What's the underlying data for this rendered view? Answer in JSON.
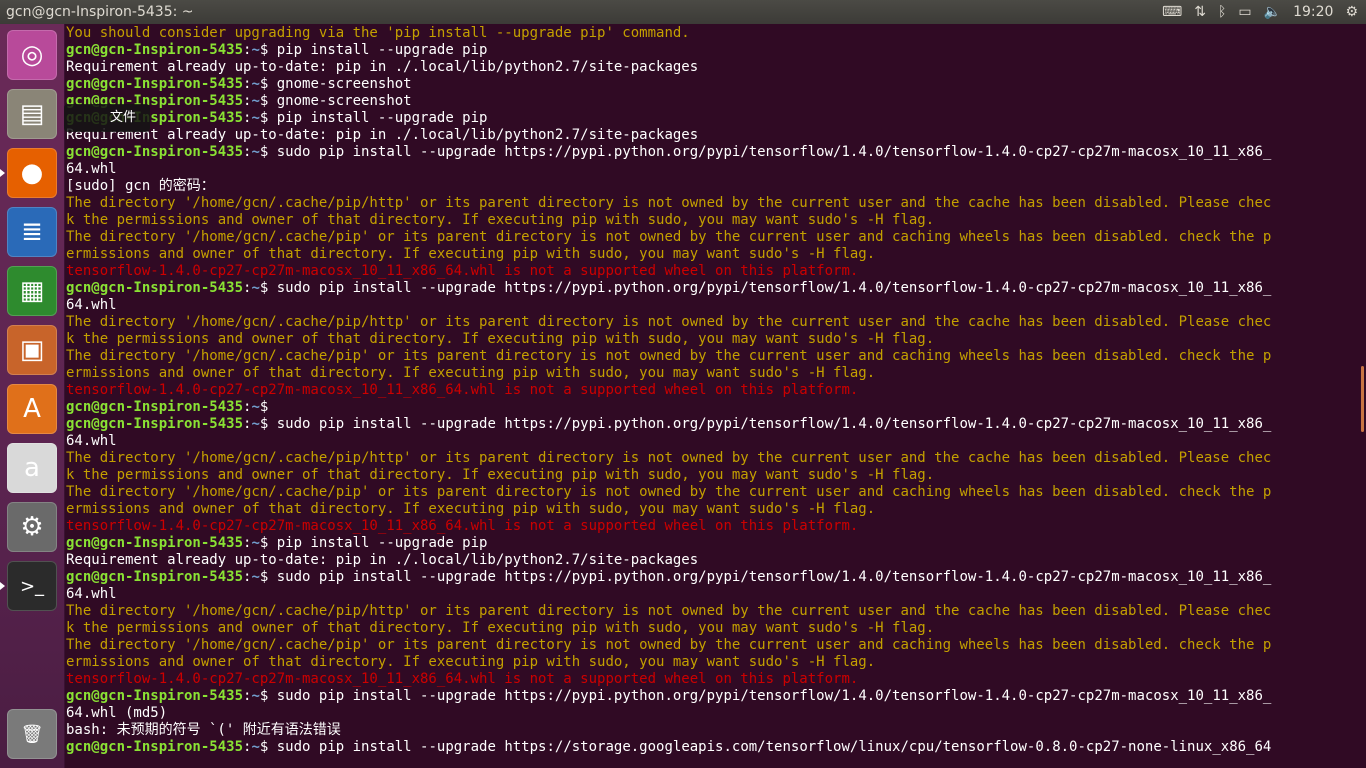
{
  "topbar": {
    "title": "gcn@gcn-Inspiron-5435: ~",
    "clock": "19:20",
    "tray_icons": [
      "keyboard-icon",
      "network-icon",
      "bluetooth-icon",
      "battery-icon",
      "volume-icon",
      "settings-icon"
    ]
  },
  "launcher": {
    "items": [
      {
        "name": "ubuntu-dash",
        "glyph": "◎",
        "color": "#b84a9a"
      },
      {
        "name": "files",
        "glyph": "▤",
        "color": "#8a8577"
      },
      {
        "name": "firefox",
        "glyph": "●",
        "color": "#e66000"
      },
      {
        "name": "writer",
        "glyph": "≣",
        "color": "#2a6ab8"
      },
      {
        "name": "calc",
        "glyph": "▦",
        "color": "#2e8b2e"
      },
      {
        "name": "impress",
        "glyph": "▣",
        "color": "#c8642a"
      },
      {
        "name": "software-center",
        "glyph": "A",
        "color": "#e0701a"
      },
      {
        "name": "amazon",
        "glyph": "a",
        "color": "#d9d9d9"
      },
      {
        "name": "system-settings",
        "glyph": "⚙",
        "color": "#6a6a6a"
      },
      {
        "name": "terminal",
        "glyph": ">_",
        "color": "#2b2b2b"
      },
      {
        "name": "trash",
        "glyph": "🗑",
        "color": "#7a7a7a"
      }
    ],
    "tooltip": "文件"
  },
  "terminal": {
    "prompt_user": "gcn@gcn-Inspiron-5435",
    "prompt_path": "~",
    "lines": [
      {
        "t": "warn",
        "text": "You should consider upgrading via the 'pip install --upgrade pip' command."
      },
      {
        "t": "prompt",
        "cmd": "pip install --upgrade pip"
      },
      {
        "t": "norm",
        "text": "Requirement already up-to-date: pip in ./.local/lib/python2.7/site-packages"
      },
      {
        "t": "prompt",
        "cmd": "gnome-screenshot"
      },
      {
        "t": "prompt",
        "cmd": "gnome-screenshot"
      },
      {
        "t": "prompt",
        "cmd": "pip install --upgrade pip"
      },
      {
        "t": "norm",
        "text": "Requirement already up-to-date: pip in ./.local/lib/python2.7/site-packages"
      },
      {
        "t": "prompt",
        "cmd": "sudo pip install --upgrade https://pypi.python.org/pypi/tensorflow/1.4.0/tensorflow-1.4.0-cp27-cp27m-macosx_10_11_x86_"
      },
      {
        "t": "norm",
        "text": "64.whl"
      },
      {
        "t": "norm",
        "text": "[sudo] gcn 的密码："
      },
      {
        "t": "warn",
        "text": "The directory '/home/gcn/.cache/pip/http' or its parent directory is not owned by the current user and the cache has been disabled. Please chec"
      },
      {
        "t": "warn",
        "text": "k the permissions and owner of that directory. If executing pip with sudo, you may want sudo's -H flag."
      },
      {
        "t": "warn",
        "text": "The directory '/home/gcn/.cache/pip' or its parent directory is not owned by the current user and caching wheels has been disabled. check the p"
      },
      {
        "t": "warn",
        "text": "ermissions and owner of that directory. If executing pip with sudo, you may want sudo's -H flag."
      },
      {
        "t": "err",
        "text": "tensorflow-1.4.0-cp27-cp27m-macosx_10_11_x86_64.whl is not a supported wheel on this platform."
      },
      {
        "t": "prompt",
        "cmd": "sudo pip install --upgrade https://pypi.python.org/pypi/tensorflow/1.4.0/tensorflow-1.4.0-cp27-cp27m-macosx_10_11_x86_"
      },
      {
        "t": "norm",
        "text": "64.whl"
      },
      {
        "t": "warn",
        "text": "The directory '/home/gcn/.cache/pip/http' or its parent directory is not owned by the current user and the cache has been disabled. Please chec"
      },
      {
        "t": "warn",
        "text": "k the permissions and owner of that directory. If executing pip with sudo, you may want sudo's -H flag."
      },
      {
        "t": "warn",
        "text": "The directory '/home/gcn/.cache/pip' or its parent directory is not owned by the current user and caching wheels has been disabled. check the p"
      },
      {
        "t": "warn",
        "text": "ermissions and owner of that directory. If executing pip with sudo, you may want sudo's -H flag."
      },
      {
        "t": "err",
        "text": "tensorflow-1.4.0-cp27-cp27m-macosx_10_11_x86_64.whl is not a supported wheel on this platform."
      },
      {
        "t": "prompt",
        "cmd": ""
      },
      {
        "t": "prompt",
        "cmd": "sudo pip install --upgrade https://pypi.python.org/pypi/tensorflow/1.4.0/tensorflow-1.4.0-cp27-cp27m-macosx_10_11_x86_"
      },
      {
        "t": "norm",
        "text": "64.whl"
      },
      {
        "t": "warn",
        "text": "The directory '/home/gcn/.cache/pip/http' or its parent directory is not owned by the current user and the cache has been disabled. Please chec"
      },
      {
        "t": "warn",
        "text": "k the permissions and owner of that directory. If executing pip with sudo, you may want sudo's -H flag."
      },
      {
        "t": "warn",
        "text": "The directory '/home/gcn/.cache/pip' or its parent directory is not owned by the current user and caching wheels has been disabled. check the p"
      },
      {
        "t": "warn",
        "text": "ermissions and owner of that directory. If executing pip with sudo, you may want sudo's -H flag."
      },
      {
        "t": "err",
        "text": "tensorflow-1.4.0-cp27-cp27m-macosx_10_11_x86_64.whl is not a supported wheel on this platform."
      },
      {
        "t": "prompt",
        "cmd": "pip install --upgrade pip"
      },
      {
        "t": "norm",
        "text": "Requirement already up-to-date: pip in ./.local/lib/python2.7/site-packages"
      },
      {
        "t": "prompt",
        "cmd": "sudo pip install --upgrade https://pypi.python.org/pypi/tensorflow/1.4.0/tensorflow-1.4.0-cp27-cp27m-macosx_10_11_x86_"
      },
      {
        "t": "norm",
        "text": "64.whl"
      },
      {
        "t": "warn",
        "text": "The directory '/home/gcn/.cache/pip/http' or its parent directory is not owned by the current user and the cache has been disabled. Please chec"
      },
      {
        "t": "warn",
        "text": "k the permissions and owner of that directory. If executing pip with sudo, you may want sudo's -H flag."
      },
      {
        "t": "warn",
        "text": "The directory '/home/gcn/.cache/pip' or its parent directory is not owned by the current user and caching wheels has been disabled. check the p"
      },
      {
        "t": "warn",
        "text": "ermissions and owner of that directory. If executing pip with sudo, you may want sudo's -H flag."
      },
      {
        "t": "err",
        "text": "tensorflow-1.4.0-cp27-cp27m-macosx_10_11_x86_64.whl is not a supported wheel on this platform."
      },
      {
        "t": "prompt",
        "cmd": "sudo pip install --upgrade https://pypi.python.org/pypi/tensorflow/1.4.0/tensorflow-1.4.0-cp27-cp27m-macosx_10_11_x86_"
      },
      {
        "t": "norm",
        "text": "64.whl (md5)"
      },
      {
        "t": "norm",
        "text": "bash: 未预期的符号 `(' 附近有语法错误"
      },
      {
        "t": "prompt",
        "cmd": "sudo pip install --upgrade https://storage.googleapis.com/tensorflow/linux/cpu/tensorflow-0.8.0-cp27-none-linux_x86_64"
      }
    ]
  }
}
